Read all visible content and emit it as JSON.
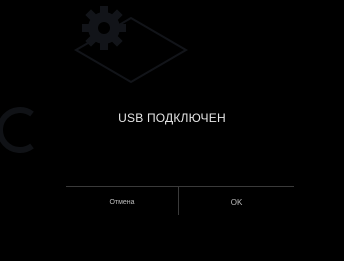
{
  "dialog": {
    "message": "USB ПОДКЛЮЧЕН",
    "cancel_label": "Отмена",
    "ok_label": "OK"
  },
  "colors": {
    "background": "#000000",
    "text": "#e6e6e6",
    "button_text": "#bdbdbd",
    "divider": "#3a3a3a",
    "watermark": "#6f7f9a"
  },
  "watermark": {
    "icon": "gear-logo-watermark"
  }
}
